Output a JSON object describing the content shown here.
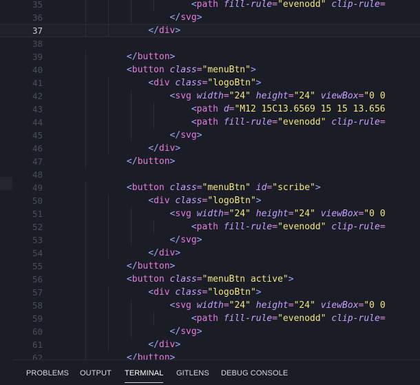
{
  "editor": {
    "lines": [
      {
        "n": "35",
        "indent": "                        ",
        "segs": [
          [
            "t",
            "<"
          ],
          [
            "tn",
            "path"
          ],
          [
            "w",
            " "
          ],
          [
            "an",
            "fill-rule"
          ],
          [
            "eq",
            "="
          ],
          [
            "av",
            "\"evenodd\""
          ],
          [
            "w",
            " "
          ],
          [
            "an",
            "clip-rule"
          ],
          [
            "eq",
            "="
          ]
        ]
      },
      {
        "n": "36",
        "indent": "                    ",
        "segs": [
          [
            "t",
            "</"
          ],
          [
            "tn",
            "svg"
          ],
          [
            "t",
            ">"
          ]
        ]
      },
      {
        "n": "37",
        "indent": "                ",
        "segs": [
          [
            "t",
            "</"
          ],
          [
            "tn",
            "div"
          ],
          [
            "t",
            ">"
          ]
        ],
        "current": true
      },
      {
        "n": "38",
        "indent": "",
        "segs": []
      },
      {
        "n": "39",
        "indent": "            ",
        "segs": [
          [
            "t",
            "</"
          ],
          [
            "tn",
            "button"
          ],
          [
            "t",
            ">"
          ]
        ]
      },
      {
        "n": "40",
        "indent": "            ",
        "segs": [
          [
            "t",
            "<"
          ],
          [
            "tn",
            "button"
          ],
          [
            "w",
            " "
          ],
          [
            "an",
            "class"
          ],
          [
            "eq",
            "="
          ],
          [
            "av",
            "\"menuBtn\""
          ],
          [
            "t",
            ">"
          ]
        ]
      },
      {
        "n": "41",
        "indent": "                ",
        "segs": [
          [
            "t",
            "<"
          ],
          [
            "tn",
            "div"
          ],
          [
            "w",
            " "
          ],
          [
            "an",
            "class"
          ],
          [
            "eq",
            "="
          ],
          [
            "av",
            "\"logoBtn\""
          ],
          [
            "t",
            ">"
          ]
        ]
      },
      {
        "n": "42",
        "indent": "                    ",
        "segs": [
          [
            "t",
            "<"
          ],
          [
            "tn",
            "svg"
          ],
          [
            "w",
            " "
          ],
          [
            "an",
            "width"
          ],
          [
            "eq",
            "="
          ],
          [
            "av",
            "\"24\""
          ],
          [
            "w",
            " "
          ],
          [
            "an",
            "height"
          ],
          [
            "eq",
            "="
          ],
          [
            "av",
            "\"24\""
          ],
          [
            "w",
            " "
          ],
          [
            "an",
            "viewBox"
          ],
          [
            "eq",
            "="
          ],
          [
            "av",
            "\"0 0"
          ]
        ]
      },
      {
        "n": "43",
        "indent": "                        ",
        "segs": [
          [
            "t",
            "<"
          ],
          [
            "tn",
            "path"
          ],
          [
            "w",
            " "
          ],
          [
            "an",
            "d"
          ],
          [
            "eq",
            "="
          ],
          [
            "av",
            "\"M12 15C13.6569 15 15 13.656"
          ]
        ]
      },
      {
        "n": "44",
        "indent": "                        ",
        "segs": [
          [
            "t",
            "<"
          ],
          [
            "tn",
            "path"
          ],
          [
            "w",
            " "
          ],
          [
            "an",
            "fill-rule"
          ],
          [
            "eq",
            "="
          ],
          [
            "av",
            "\"evenodd\""
          ],
          [
            "w",
            " "
          ],
          [
            "an",
            "clip-rule"
          ],
          [
            "eq",
            "="
          ]
        ]
      },
      {
        "n": "45",
        "indent": "                    ",
        "segs": [
          [
            "t",
            "</"
          ],
          [
            "tn",
            "svg"
          ],
          [
            "t",
            ">"
          ]
        ]
      },
      {
        "n": "46",
        "indent": "                ",
        "segs": [
          [
            "t",
            "</"
          ],
          [
            "tn",
            "div"
          ],
          [
            "t",
            ">"
          ]
        ]
      },
      {
        "n": "47",
        "indent": "            ",
        "segs": [
          [
            "t",
            "</"
          ],
          [
            "tn",
            "button"
          ],
          [
            "t",
            ">"
          ]
        ]
      },
      {
        "n": "48",
        "indent": "",
        "segs": []
      },
      {
        "n": "49",
        "indent": "            ",
        "segs": [
          [
            "t",
            "<"
          ],
          [
            "tn",
            "button"
          ],
          [
            "w",
            " "
          ],
          [
            "an",
            "class"
          ],
          [
            "eq",
            "="
          ],
          [
            "av",
            "\"menuBtn\""
          ],
          [
            "w",
            " "
          ],
          [
            "an",
            "id"
          ],
          [
            "eq",
            "="
          ],
          [
            "av",
            "\"scribe\""
          ],
          [
            "t",
            ">"
          ]
        ]
      },
      {
        "n": "50",
        "indent": "                ",
        "segs": [
          [
            "t",
            "<"
          ],
          [
            "tn",
            "div"
          ],
          [
            "w",
            " "
          ],
          [
            "an",
            "class"
          ],
          [
            "eq",
            "="
          ],
          [
            "av",
            "\"logoBtn\""
          ],
          [
            "t",
            ">"
          ]
        ]
      },
      {
        "n": "51",
        "indent": "                    ",
        "segs": [
          [
            "t",
            "<"
          ],
          [
            "tn",
            "svg"
          ],
          [
            "w",
            " "
          ],
          [
            "an",
            "width"
          ],
          [
            "eq",
            "="
          ],
          [
            "av",
            "\"24\""
          ],
          [
            "w",
            " "
          ],
          [
            "an",
            "height"
          ],
          [
            "eq",
            "="
          ],
          [
            "av",
            "\"24\""
          ],
          [
            "w",
            " "
          ],
          [
            "an",
            "viewBox"
          ],
          [
            "eq",
            "="
          ],
          [
            "av",
            "\"0 0"
          ]
        ]
      },
      {
        "n": "52",
        "indent": "                        ",
        "segs": [
          [
            "t",
            "<"
          ],
          [
            "tn",
            "path"
          ],
          [
            "w",
            " "
          ],
          [
            "an",
            "fill-rule"
          ],
          [
            "eq",
            "="
          ],
          [
            "av",
            "\"evenodd\""
          ],
          [
            "w",
            " "
          ],
          [
            "an",
            "clip-rule"
          ],
          [
            "eq",
            "="
          ]
        ]
      },
      {
        "n": "53",
        "indent": "                    ",
        "segs": [
          [
            "t",
            "</"
          ],
          [
            "tn",
            "svg"
          ],
          [
            "t",
            ">"
          ]
        ]
      },
      {
        "n": "54",
        "indent": "                ",
        "segs": [
          [
            "t",
            "</"
          ],
          [
            "tn",
            "div"
          ],
          [
            "t",
            ">"
          ]
        ]
      },
      {
        "n": "55",
        "indent": "            ",
        "segs": [
          [
            "t",
            "</"
          ],
          [
            "tn",
            "button"
          ],
          [
            "t",
            ">"
          ]
        ]
      },
      {
        "n": "56",
        "indent": "            ",
        "segs": [
          [
            "t",
            "<"
          ],
          [
            "tn",
            "button"
          ],
          [
            "w",
            " "
          ],
          [
            "an",
            "class"
          ],
          [
            "eq",
            "="
          ],
          [
            "av",
            "\"menuBtn active\""
          ],
          [
            "t",
            ">"
          ]
        ]
      },
      {
        "n": "57",
        "indent": "                ",
        "segs": [
          [
            "t",
            "<"
          ],
          [
            "tn",
            "div"
          ],
          [
            "w",
            " "
          ],
          [
            "an",
            "class"
          ],
          [
            "eq",
            "="
          ],
          [
            "av",
            "\"logoBtn\""
          ],
          [
            "t",
            ">"
          ]
        ]
      },
      {
        "n": "58",
        "indent": "                    ",
        "segs": [
          [
            "t",
            "<"
          ],
          [
            "tn",
            "svg"
          ],
          [
            "w",
            " "
          ],
          [
            "an",
            "width"
          ],
          [
            "eq",
            "="
          ],
          [
            "av",
            "\"24\""
          ],
          [
            "w",
            " "
          ],
          [
            "an",
            "height"
          ],
          [
            "eq",
            "="
          ],
          [
            "av",
            "\"24\""
          ],
          [
            "w",
            " "
          ],
          [
            "an",
            "viewBox"
          ],
          [
            "eq",
            "="
          ],
          [
            "av",
            "\"0 0"
          ]
        ]
      },
      {
        "n": "59",
        "indent": "                        ",
        "segs": [
          [
            "t",
            "<"
          ],
          [
            "tn",
            "path"
          ],
          [
            "w",
            " "
          ],
          [
            "an",
            "fill-rule"
          ],
          [
            "eq",
            "="
          ],
          [
            "av",
            "\"evenodd\""
          ],
          [
            "w",
            " "
          ],
          [
            "an",
            "clip-rule"
          ],
          [
            "eq",
            "="
          ]
        ]
      },
      {
        "n": "60",
        "indent": "                    ",
        "segs": [
          [
            "t",
            "</"
          ],
          [
            "tn",
            "svg"
          ],
          [
            "t",
            ">"
          ]
        ]
      },
      {
        "n": "61",
        "indent": "                ",
        "segs": [
          [
            "t",
            "</"
          ],
          [
            "tn",
            "div"
          ],
          [
            "t",
            ">"
          ]
        ]
      },
      {
        "n": "62",
        "indent": "            ",
        "segs": [
          [
            "t",
            "</"
          ],
          [
            "tn",
            "button"
          ],
          [
            "t",
            ">"
          ]
        ]
      }
    ]
  },
  "panel": {
    "tabs": [
      {
        "label": "PROBLEMS",
        "name": "tab-problems",
        "active": false
      },
      {
        "label": "OUTPUT",
        "name": "tab-output",
        "active": false
      },
      {
        "label": "TERMINAL",
        "name": "tab-terminal",
        "active": true
      },
      {
        "label": "GITLENS",
        "name": "tab-gitlens",
        "active": false
      },
      {
        "label": "DEBUG CONSOLE",
        "name": "tab-debug-console",
        "active": false
      }
    ]
  }
}
